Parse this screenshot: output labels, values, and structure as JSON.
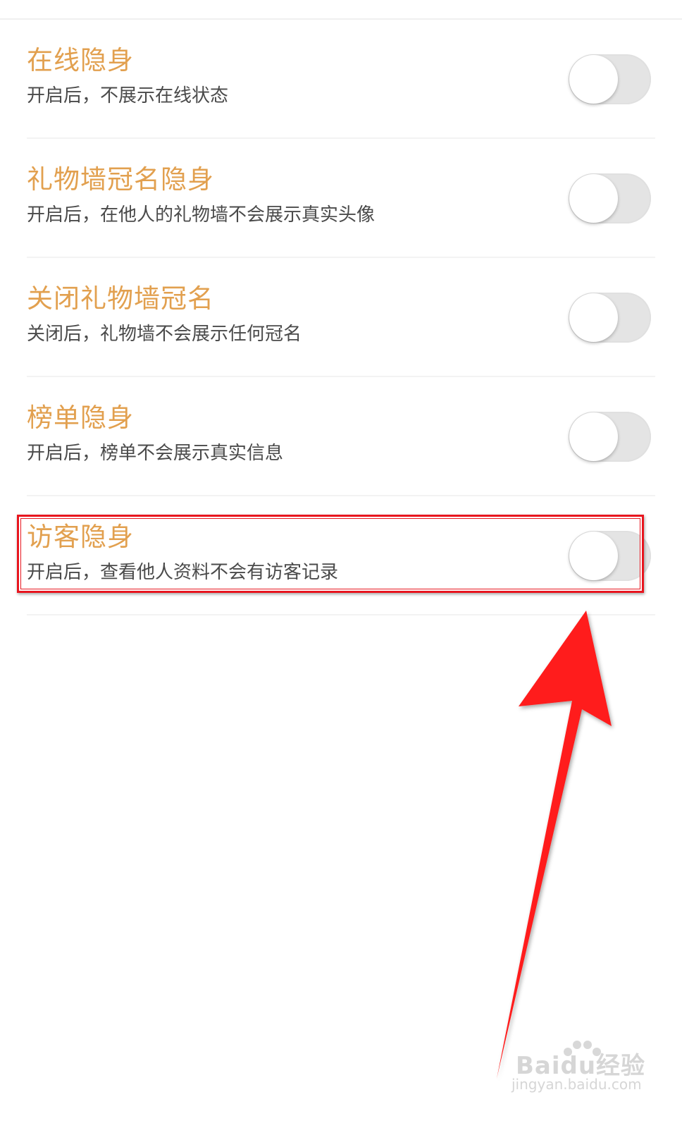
{
  "settings": [
    {
      "title": "在线隐身",
      "description": "开启后，不展示在线状态",
      "enabled": false
    },
    {
      "title": "礼物墙冠名隐身",
      "description": "开启后，在他人的礼物墙不会展示真实头像",
      "enabled": false
    },
    {
      "title": "关闭礼物墙冠名",
      "description": "关闭后，礼物墙不会展示任何冠名",
      "enabled": false
    },
    {
      "title": "榜单隐身",
      "description": "开启后，榜单不会展示真实信息",
      "enabled": false
    },
    {
      "title": "访客隐身",
      "description": "开启后，查看他人资料不会有访客记录",
      "enabled": false
    }
  ],
  "annotation": {
    "highlighted_setting": "访客隐身",
    "box_color": "#e8161f",
    "arrow_color": "#ff1a1a"
  },
  "colors": {
    "title": "#e2a04f",
    "description": "#4a4a4a",
    "toggle_off": "#e4e4e4"
  },
  "watermark": {
    "brand": "Baidu经验",
    "url": "jingyan.baidu.com"
  }
}
